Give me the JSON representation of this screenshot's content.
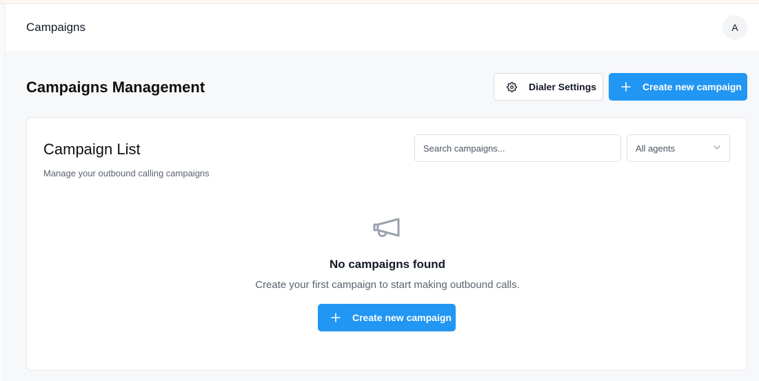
{
  "header": {
    "title": "Campaigns",
    "avatar_initial": "A"
  },
  "page": {
    "title": "Campaigns Management"
  },
  "actions": {
    "dialer_settings_label": "Dialer Settings",
    "create_campaign_label": "Create new campaign"
  },
  "campaign_list": {
    "title": "Campaign List",
    "subtitle": "Manage your outbound calling campaigns",
    "search": {
      "placeholder": "Search campaigns...",
      "value": ""
    },
    "agent_filter": {
      "selected": "All agents"
    }
  },
  "empty_state": {
    "title": "No campaigns found",
    "message": "Create your first campaign to start making outbound calls.",
    "button_label": "Create new campaign"
  },
  "colors": {
    "primary": "#2196f3",
    "background": "#f7f8fa"
  },
  "icons": [
    "gear-icon",
    "plus-icon",
    "chevron-down-icon",
    "megaphone-icon"
  ]
}
